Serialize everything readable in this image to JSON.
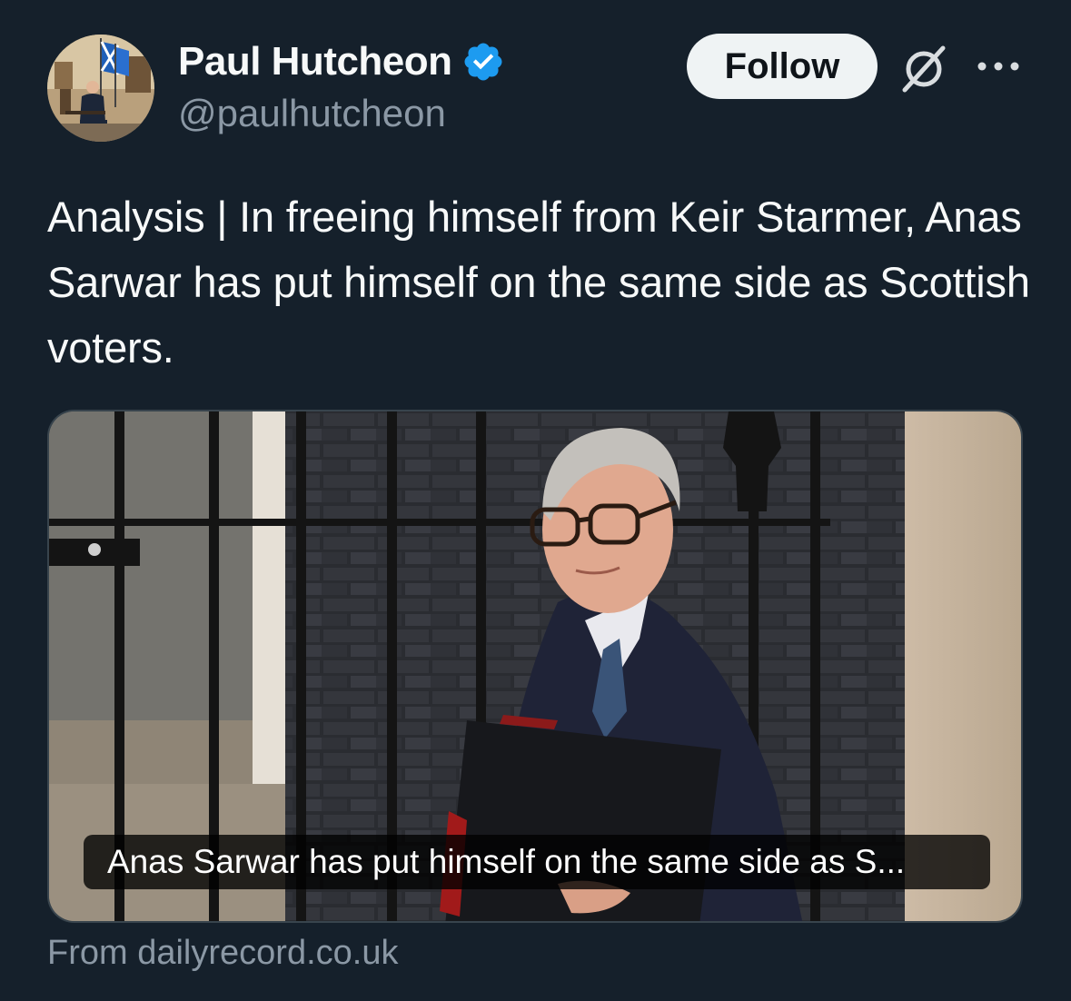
{
  "author": {
    "display_name": "Paul Hutcheon",
    "handle": "@paulhutcheon",
    "verified": true,
    "avatar_icon": "profile-photo"
  },
  "actions": {
    "follow_label": "Follow",
    "grok_icon": "grok-icon",
    "more_icon": "more-horizontal-icon"
  },
  "tweet": {
    "text": "Analysis | In freeing himself from Keir Starmer, Anas Sarwar has put himself on the same side as Scottish voters."
  },
  "link_card": {
    "caption": "Anas Sarwar has put himself on the same side as S...",
    "source": "From dailyrecord.co.uk"
  },
  "colors": {
    "background": "#15202b",
    "text_primary": "#f7f9f9",
    "text_secondary": "#8b98a5",
    "verified_blue": "#1d9bf0",
    "follow_button_bg": "#eff3f4",
    "card_border": "#38444d"
  }
}
